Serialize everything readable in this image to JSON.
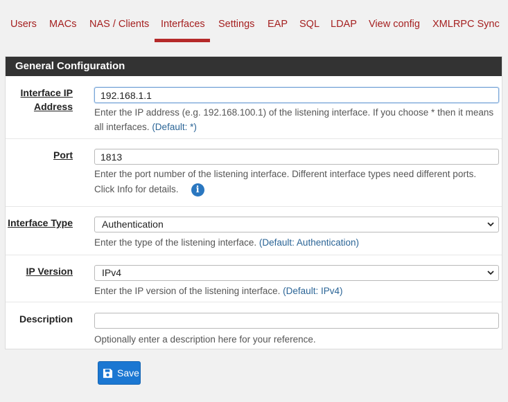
{
  "tabs": [
    {
      "label": "Users"
    },
    {
      "label": "MACs"
    },
    {
      "label": "NAS / Clients"
    },
    {
      "label": "Interfaces"
    },
    {
      "label": "Settings"
    },
    {
      "label": "EAP"
    },
    {
      "label": "SQL"
    },
    {
      "label": "LDAP"
    },
    {
      "label": "View config"
    },
    {
      "label": "XMLRPC Sync"
    }
  ],
  "active_tab": "Interfaces",
  "colors": {
    "accent": "#b52a2a",
    "primary": "#1b77d2",
    "header": "#333333"
  },
  "panel": {
    "title": "General Configuration"
  },
  "fields": {
    "interface_ip": {
      "label_line1": "Interface IP",
      "label_line2": "Address",
      "value": "192.168.1.1",
      "help": "Enter the IP address (e.g. 192.168.100.1) of the listening interface. If you choose * then it means all interfaces.",
      "default": "(Default: *)"
    },
    "port": {
      "label": "Port",
      "value": "1813",
      "help": "Enter the port number of the listening interface. Different interface types need different ports. Click Info for details.",
      "info_icon": "i"
    },
    "interface_type": {
      "label": "Interface Type",
      "value": "Authentication",
      "help": "Enter the type of the listening interface.",
      "default": "(Default: Authentication)"
    },
    "ip_version": {
      "label": "IP Version",
      "value": "IPv4",
      "help": "Enter the IP version of the listening interface.",
      "default": "(Default: IPv4)"
    },
    "description": {
      "label": "Description",
      "value": "",
      "help": "Optionally enter a description here for your reference."
    }
  },
  "save": {
    "label": "Save",
    "icon": "save-icon"
  }
}
